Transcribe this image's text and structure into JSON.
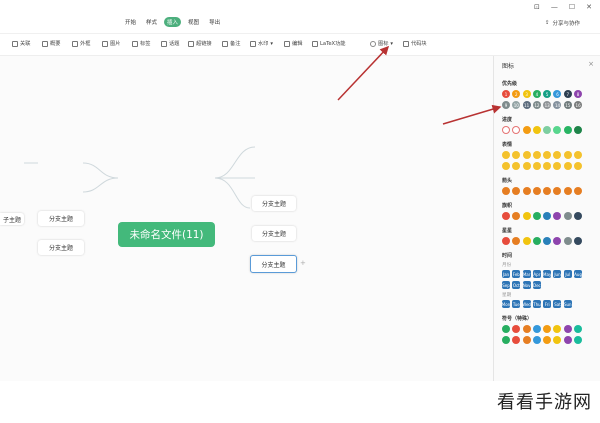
{
  "menubar": {
    "tabs": [
      "开始",
      "样式",
      "插入",
      "视图",
      "导出"
    ],
    "active_tab": "插入",
    "share_label": "分享与协作"
  },
  "toolbar": {
    "items": [
      "关联",
      "概要",
      "外框",
      "图片",
      "标签",
      "话题",
      "超链接",
      "备注",
      "水印",
      "编辑",
      "LaTeX功能",
      "图标",
      "代码块"
    ],
    "highlighted": "图标"
  },
  "mindmap": {
    "root": "未命名文件(11)",
    "left_branches": [
      "分支主题",
      "分支主题"
    ],
    "left_sub": "子主题",
    "right_branches": [
      "分支主题",
      "分支主题",
      "分支主题"
    ],
    "selected_right_index": 2
  },
  "panel": {
    "title": "图标",
    "sections": [
      {
        "title": "优先级",
        "rows": [
          [
            "1",
            "2",
            "3",
            "4",
            "5",
            "6",
            "7",
            "8"
          ],
          [
            "9",
            "10",
            "11",
            "12",
            "13",
            "14",
            "15",
            "16"
          ]
        ],
        "colors": [
          "#e74c3c",
          "#f39c12",
          "#f1c40f",
          "#27ae60",
          "#16a085",
          "#3498db",
          "#2c3e50",
          "#8e44ad",
          "#7f8c8d",
          "#95a5a6",
          "#5d6d7e",
          "#7f8c8d",
          "#909497",
          "#85929e",
          "#707b7c",
          "#7b7d7d"
        ]
      },
      {
        "title": "进度",
        "rows": [
          [
            "",
            "",
            "",
            "",
            "",
            "",
            "",
            ""
          ]
        ],
        "colors": [
          "#ffffff",
          "#ffffff",
          "#f39c12",
          "#f1c40f",
          "#7dcea0",
          "#58d68d",
          "#28b463",
          "#1e8449"
        ]
      },
      {
        "title": "表情",
        "rows": [
          [
            "",
            "",
            "",
            "",
            "",
            "",
            "",
            ""
          ],
          [
            "",
            "",
            "",
            "",
            "",
            "",
            "",
            ""
          ]
        ],
        "colors": [
          "#f4c22c"
        ]
      },
      {
        "title": "箭头",
        "rows": [
          [
            "",
            "",
            "",
            "",
            "",
            "",
            "",
            ""
          ]
        ],
        "colors": [
          "#e67e22"
        ]
      },
      {
        "title": "旗帜",
        "rows": [
          [
            "",
            "",
            "",
            "",
            "",
            "",
            "",
            ""
          ]
        ],
        "colors": [
          "#e74c3c",
          "#e67e22",
          "#f1c40f",
          "#27ae60",
          "#2980b9",
          "#8e44ad",
          "#7f8c8d",
          "#34495e"
        ]
      },
      {
        "title": "星星",
        "rows": [
          [
            "",
            "",
            "",
            "",
            "",
            "",
            "",
            ""
          ]
        ],
        "colors": [
          "#e74c3c",
          "#e67e22",
          "#f1c40f",
          "#27ae60",
          "#2980b9",
          "#8e44ad",
          "#7f8c8d",
          "#34495e"
        ]
      },
      {
        "title": "时间",
        "sub1": "月份",
        "rows": [
          [
            "Jan",
            "Feb",
            "Mar",
            "Apr",
            "May",
            "Jun",
            "Jul",
            "Aug"
          ],
          [
            "Sep",
            "Oct",
            "Nov",
            "Dec",
            "",
            "",
            "",
            ""
          ]
        ],
        "sub2": "星期",
        "rows2": [
          [
            "Mon",
            "Tue",
            "Wed",
            "Thu",
            "Fri",
            "Sat",
            "Sun",
            ""
          ]
        ],
        "colors": [
          "#2e75b6"
        ]
      },
      {
        "title": "符号（特殊）",
        "rows": [
          [
            "",
            "",
            "",
            "",
            "",
            "",
            "",
            ""
          ],
          [
            "",
            "",
            "",
            "",
            "",
            "",
            "",
            ""
          ]
        ],
        "colors": [
          "#27ae60",
          "#e74c3c",
          "#e67e22",
          "#3498db",
          "#f39c12",
          "#f1c40f",
          "#8e44ad",
          "#1abc9c"
        ]
      }
    ]
  },
  "watermark": "看看手游网"
}
